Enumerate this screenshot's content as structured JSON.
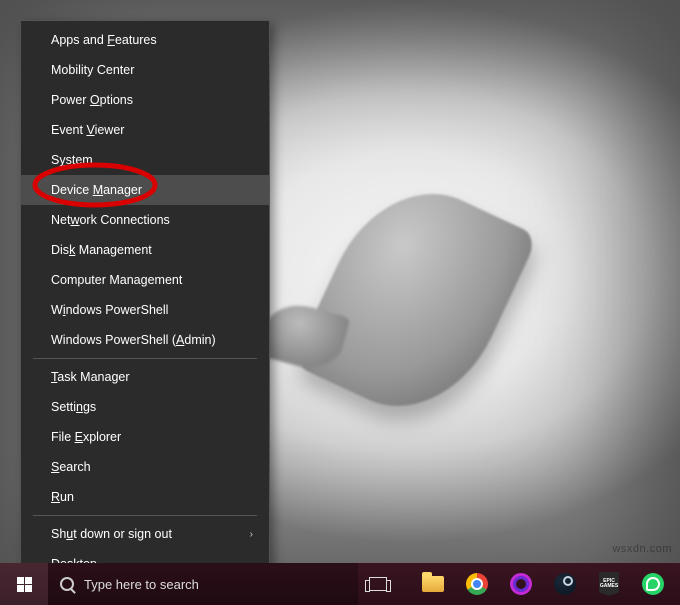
{
  "menu": {
    "groups": [
      [
        {
          "pre": "Apps and ",
          "u": "F",
          "post": "eatures"
        },
        {
          "label": "Mobility Center"
        },
        {
          "pre": "Power ",
          "u": "O",
          "post": "ptions"
        },
        {
          "pre": "Event ",
          "u": "V",
          "post": "iewer"
        },
        {
          "pre": "S",
          "u": "y",
          "post": "stem"
        },
        {
          "pre": "Device ",
          "u": "M",
          "post": "anager",
          "hover": true,
          "highlighted": true
        },
        {
          "pre": "Net",
          "u": "w",
          "post": "ork Connections"
        },
        {
          "pre": "Dis",
          "u": "k",
          "post": " Management"
        },
        {
          "pre": "Computer Mana",
          "u": "g",
          "post": "ement"
        },
        {
          "pre": "W",
          "u": "i",
          "post": "ndows PowerShell"
        },
        {
          "pre": "Windows PowerShell (",
          "u": "A",
          "post": "dmin)"
        }
      ],
      [
        {
          "pre": "",
          "u": "T",
          "post": "ask Manager"
        },
        {
          "pre": "Setti",
          "u": "n",
          "post": "gs"
        },
        {
          "pre": "File ",
          "u": "E",
          "post": "xplorer"
        },
        {
          "pre": "",
          "u": "S",
          "post": "earch"
        },
        {
          "pre": "",
          "u": "R",
          "post": "un"
        }
      ],
      [
        {
          "pre": "Sh",
          "u": "u",
          "post": "t down or sign out",
          "submenu": true
        },
        {
          "pre": "",
          "u": "D",
          "post": "esktop"
        }
      ]
    ]
  },
  "taskbar": {
    "search_placeholder": "Type here to search",
    "tray_icons": [
      "folder",
      "chrome",
      "opera",
      "steam",
      "epic",
      "whatsapp"
    ],
    "epic_label": "EPIC GAMES"
  },
  "watermark": "wsxdn.com"
}
